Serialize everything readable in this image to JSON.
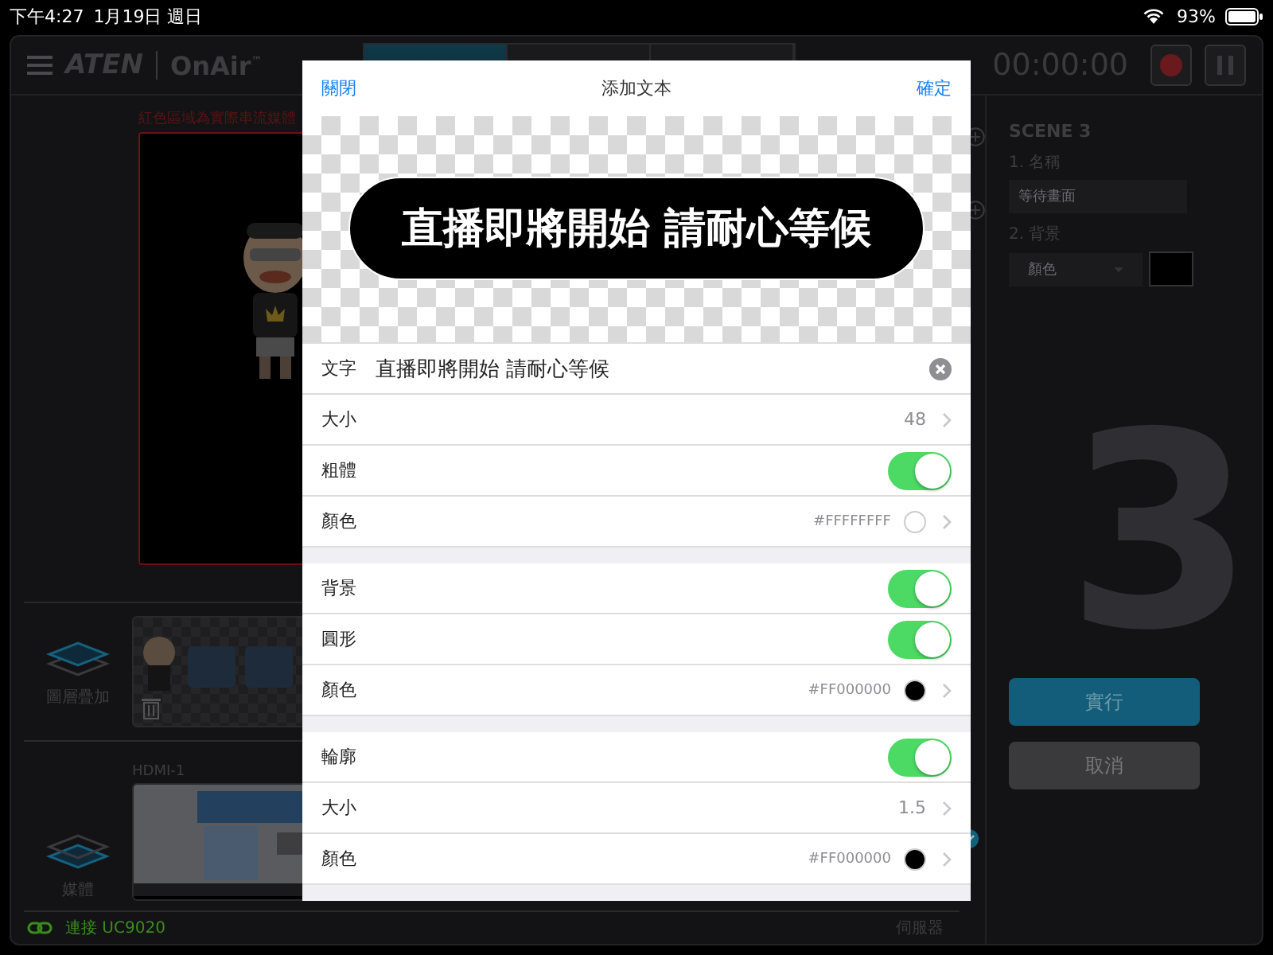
{
  "status_bar": {
    "time": "下午4:27",
    "date": "1月19日 週日",
    "battery": "93%"
  },
  "top_bar": {
    "brand": "ATEN",
    "product": "OnAir",
    "trademark": "™",
    "timer": "00:00:00",
    "tabs": [
      {
        "selected": true
      },
      {
        "selected": false
      },
      {
        "selected": false
      }
    ]
  },
  "preview": {
    "notice": "紅色區域為實際串流媒體"
  },
  "layers": {
    "label": "圖層疊加"
  },
  "media": {
    "label": "媒體",
    "source": "HDMI-1"
  },
  "footer": {
    "connection": "連接 UC9020",
    "server": "伺服器"
  },
  "scene_panel": {
    "title": "SCENE 3",
    "name_label": "1. 名稱",
    "name_value": "等待畫面",
    "background_label": "2. 背景",
    "background_type": "顏色",
    "big_number": "3",
    "buttons": [
      "實行",
      "取消"
    ]
  },
  "dialog": {
    "close": "關閉",
    "title": "添加文本",
    "confirm": "確定",
    "preview_text": "直播即將開始 請耐心等候",
    "sections": [
      [
        {
          "kind": "text",
          "label": "文字",
          "value": "直播即將開始 請耐心等候"
        },
        {
          "kind": "value",
          "label": "大小",
          "value": "48"
        },
        {
          "kind": "toggle",
          "label": "粗體",
          "on": true
        },
        {
          "kind": "color",
          "label": "顏色",
          "value": "#FFFFFFFF",
          "color": "#ffffff"
        }
      ],
      [
        {
          "kind": "toggle",
          "label": "背景",
          "on": true
        },
        {
          "kind": "toggle",
          "label": "圓形",
          "on": true
        },
        {
          "kind": "color",
          "label": "顏色",
          "value": "#FF000000",
          "color": "#000000"
        }
      ],
      [
        {
          "kind": "toggle",
          "label": "輪廓",
          "on": true
        },
        {
          "kind": "value",
          "label": "大小",
          "value": "1.5"
        },
        {
          "kind": "color",
          "label": "顏色",
          "value": "#FF000000",
          "color": "#000000"
        }
      ]
    ]
  }
}
